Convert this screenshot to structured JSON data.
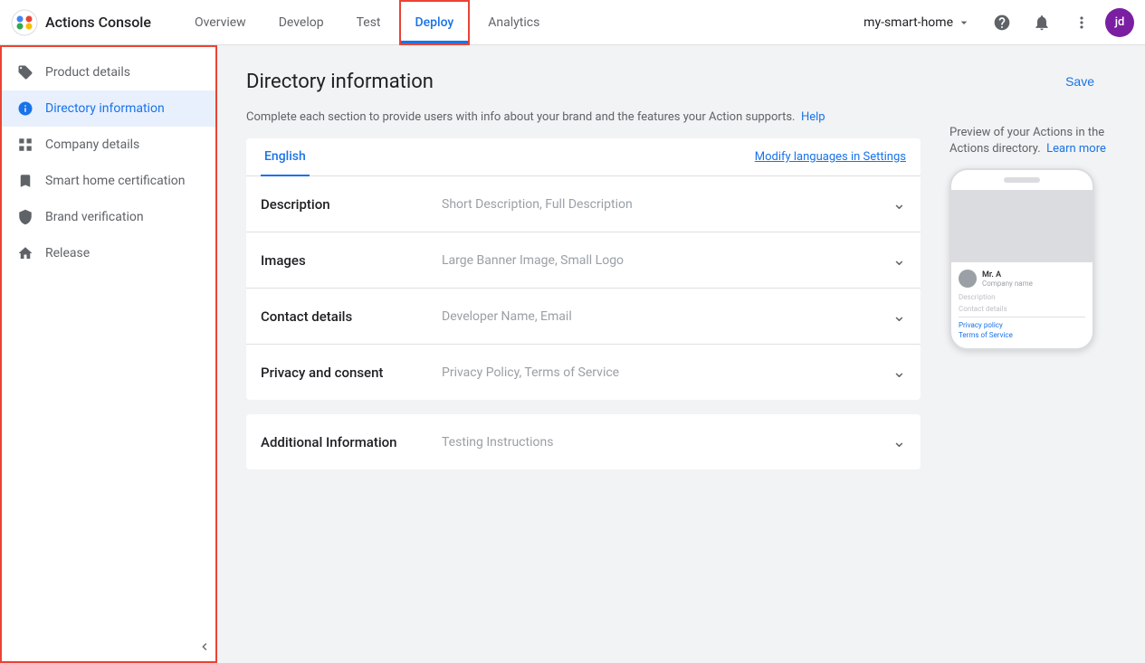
{
  "app": {
    "title": "Actions Console",
    "logo_colors": [
      "#4285f4",
      "#ea4335",
      "#fbbc04",
      "#34a853"
    ]
  },
  "nav": {
    "links": [
      {
        "label": "Overview",
        "id": "overview",
        "active": false
      },
      {
        "label": "Develop",
        "id": "develop",
        "active": false
      },
      {
        "label": "Test",
        "id": "test",
        "active": false
      },
      {
        "label": "Deploy",
        "id": "deploy",
        "active": true
      },
      {
        "label": "Analytics",
        "id": "analytics",
        "active": false
      }
    ],
    "project": "my-smart-home",
    "avatar_label": "jd"
  },
  "sidebar": {
    "items": [
      {
        "id": "product-details",
        "label": "Product details",
        "icon": "tag",
        "active": false
      },
      {
        "id": "directory-information",
        "label": "Directory information",
        "icon": "info",
        "active": true
      },
      {
        "id": "company-details",
        "label": "Company details",
        "icon": "grid",
        "active": false
      },
      {
        "id": "smart-home-certification",
        "label": "Smart home certification",
        "icon": "bookmark",
        "active": false
      },
      {
        "id": "brand-verification",
        "label": "Brand verification",
        "icon": "shield",
        "active": false
      },
      {
        "id": "release",
        "label": "Release",
        "icon": "bell",
        "active": false
      }
    ]
  },
  "page": {
    "title": "Directory information",
    "save_label": "Save",
    "info_text": "Complete each section to provide users with info about your brand and the features your Action supports.",
    "help_link": "Help",
    "language_tab": "English",
    "modify_lang_label": "Modify languages in Settings"
  },
  "sections": [
    {
      "id": "description",
      "title": "Description",
      "desc": "Short Description, Full Description"
    },
    {
      "id": "images",
      "title": "Images",
      "desc": "Large Banner Image, Small Logo"
    },
    {
      "id": "contact-details",
      "title": "Contact details",
      "desc": "Developer Name, Email"
    },
    {
      "id": "privacy-consent",
      "title": "Privacy and consent",
      "desc": "Privacy Policy, Terms of Service"
    }
  ],
  "additional": {
    "title": "Additional Information",
    "desc": "Testing Instructions"
  },
  "preview": {
    "title": "Preview of your Actions in the Actions directory.",
    "learn_more": "Learn more",
    "profile_name": "Mr. A",
    "company_name": "Company name",
    "description_label": "Description",
    "contact_label": "Contact details",
    "privacy_label": "Privacy policy",
    "terms_label": "Terms of Service"
  }
}
